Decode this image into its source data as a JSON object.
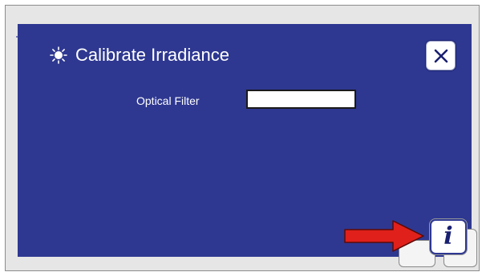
{
  "dialog": {
    "title": "Calibrate Irradiance",
    "close_label": "✕"
  },
  "form": {
    "optical_filter_label": "Optical Filter",
    "optical_filter_value": ""
  },
  "info_button": {
    "label": "i"
  },
  "colors": {
    "panel": "#2e3891",
    "arrow": "#e0201a",
    "screen": "#e6e6e6"
  },
  "icons": {
    "title_icon": "sun-icon",
    "close_icon": "close-icon",
    "info_icon": "info-icon",
    "annotation": "red-arrow-icon",
    "corner": "crosshair-icon"
  }
}
